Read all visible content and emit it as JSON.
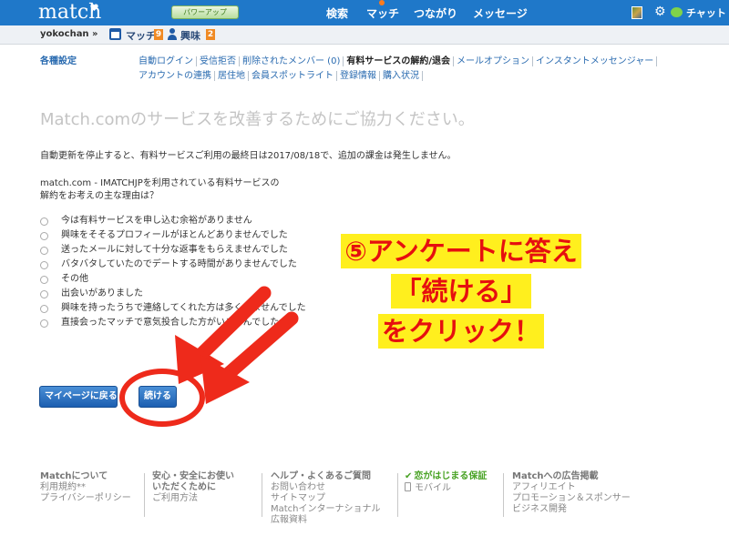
{
  "header": {
    "logo": "match",
    "power_up": "パワーアップ",
    "nav": [
      "検索",
      "マッチ",
      "つながり",
      "メッセージ"
    ],
    "chat": "チャット"
  },
  "subbar": {
    "username": "yokochan »",
    "match_label": "マッチ",
    "match_count": "9",
    "interest_label": "興味",
    "interest_count": "2"
  },
  "settings": {
    "title": "各種設定",
    "row1": [
      "自動ログイン",
      "受信拒否",
      "削除されたメンバー (0)",
      "有料サービスの解約/退会",
      "メールオプション",
      "インスタントメッセンジャー"
    ],
    "row2": [
      "アカウントの連携",
      "居住地",
      "会員スポットライト",
      "登録情報",
      "購入状況"
    ],
    "active_index": 3
  },
  "main": {
    "heading": "Match.comのサービスを改善するためにご協力ください。",
    "notice": "自動更新を停止すると、有料サービスご利用の最終日は2017/08/18で、追加の課金は発生しません。",
    "question_line1": "match.com - IMATCHJPを利用されている有料サービスの",
    "question_line2": "解約をお考えの主な理由は？",
    "options": [
      "今は有料サービスを申し込む余裕がありません",
      "興味をそそるプロフィールがほとんどありませんでした",
      "送ったメールに対して十分な返事をもらえませんでした",
      "バタバタしていたのでデートする時間がありませんでした",
      "その他",
      "出会いがありました",
      "興味を持ったうちで連絡してくれた方は多くいませんでした",
      "直接会ったマッチで意気投合した方がいませんでした"
    ],
    "back_button": "マイページに戻る",
    "continue_button": "続ける"
  },
  "annotation": {
    "line1": "⑤アンケートに答え",
    "line2": "「続ける」",
    "line3": "をクリック！"
  },
  "footer": {
    "col1": {
      "title": "Matchについて",
      "items": [
        "利用規約**",
        "プライバシーポリシー"
      ]
    },
    "col2": {
      "title": "安心・安全にお使いいただくために",
      "title_line1": "安心・安全にお使い",
      "title_line2": "いただくために",
      "items": [
        "ご利用方法"
      ]
    },
    "col3": {
      "title": "ヘルプ・よくあるご質問",
      "items": [
        "お問い合わせ",
        "サイトマップ",
        "Matchインターナショナル",
        "広報資料"
      ]
    },
    "col4": {
      "title": "恋がはじまる保証",
      "items": [
        "モバイル"
      ]
    },
    "col5": {
      "title": "Matchへの広告掲載",
      "items": [
        "アフィリエイト",
        "プロモーション＆スポンサー",
        "ビジネス開発"
      ]
    }
  },
  "colors": {
    "topbar": "#1f78c9",
    "annotation_bg": "#ffef1e",
    "annotation_text": "#e60f0f",
    "arrow": "#ee2a1b"
  }
}
